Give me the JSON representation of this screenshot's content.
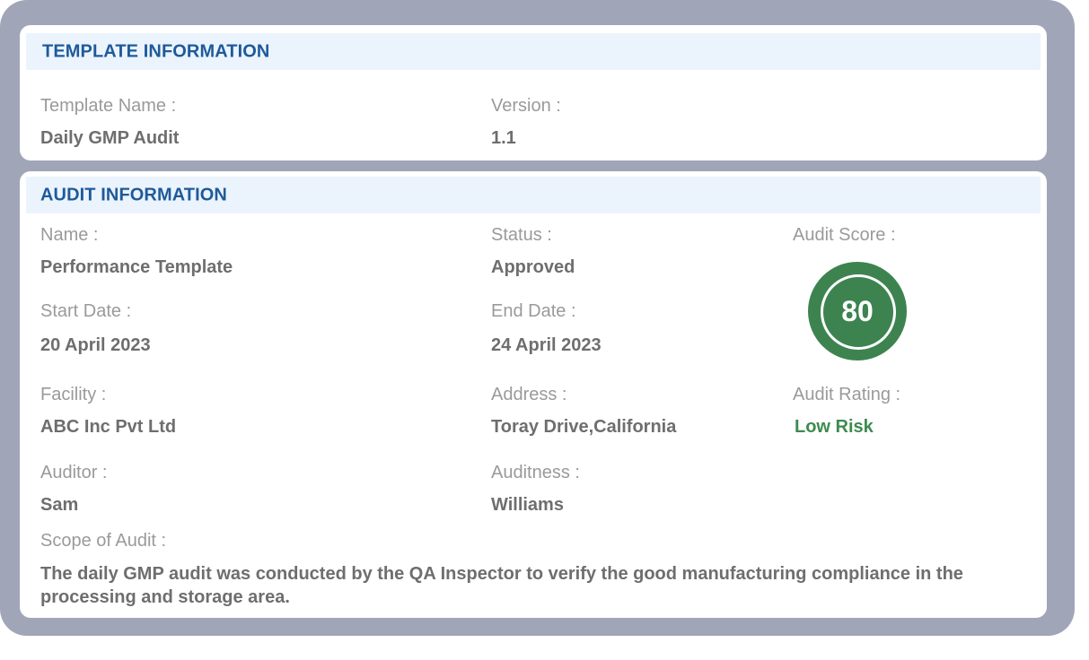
{
  "template_info": {
    "title": "TEMPLATE INFORMATION",
    "template_name_label": "Template Name :",
    "template_name_value": "Daily GMP Audit",
    "version_label": "Version :",
    "version_value": "1.1"
  },
  "audit_info": {
    "title": "AUDIT INFORMATION",
    "name_label": "Name :",
    "name_value": "Performance Template",
    "status_label": "Status :",
    "status_value": "Approved",
    "audit_score_label": "Audit Score :",
    "audit_score_value": "80",
    "start_date_label": "Start Date :",
    "start_date_value": "20 April 2023",
    "end_date_label": "End Date :",
    "end_date_value": "24 April 2023",
    "facility_label": "Facility :",
    "facility_value": "ABC Inc Pvt Ltd",
    "address_label": "Address  :",
    "address_value": "Toray Drive,California",
    "audit_rating_label": "Audit Rating  :",
    "audit_rating_value": "Low Risk",
    "auditor_label": "Auditor :",
    "auditor_value": "Sam",
    "auditness_label": "Auditness  :",
    "auditness_value": "Williams",
    "scope_label": "Scope of Audit :",
    "scope_value": "The daily GMP audit was conducted by the QA Inspector to verify the good manufacturing compliance in the processing and storage area."
  },
  "colors": {
    "frame": "#a1a5b8",
    "header_bg": "#ebf4fd",
    "header_text": "#1f5a9a",
    "score_circle": "#3d8350",
    "rating_text": "#3d8b4f"
  }
}
